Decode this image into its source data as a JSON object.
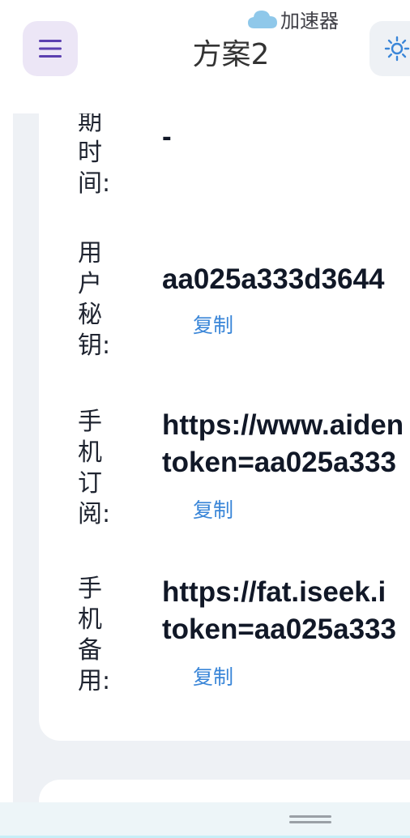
{
  "header": {
    "title": "方案2",
    "cloud_label": "加速器",
    "menu_icon": "hamburger-icon",
    "theme_icon": "sun-icon"
  },
  "rows": [
    {
      "label_chars": [
        "期",
        "时",
        "间:"
      ],
      "value_lines": [
        "-"
      ]
    },
    {
      "label_chars": [
        "用",
        "户",
        "秘",
        "钥:"
      ],
      "value_lines": [
        "aa025a333d3644"
      ],
      "copy_label": "复制"
    },
    {
      "label_chars": [
        "手",
        "机",
        "订",
        "阅:"
      ],
      "value_lines": [
        "https://www.aiden",
        "token=aa025a333"
      ],
      "copy_label": "复制"
    },
    {
      "label_chars": [
        "手",
        "机",
        "备",
        "用:"
      ],
      "value_lines": [
        "https://fat.iseek.i",
        "token=aa025a333"
      ],
      "copy_label": "复制"
    }
  ],
  "colors": {
    "accent": "#3a86d8",
    "menu_bg": "#ece6f6",
    "menu_icon": "#5b3fb0",
    "page_bg": "#eef1f5"
  }
}
